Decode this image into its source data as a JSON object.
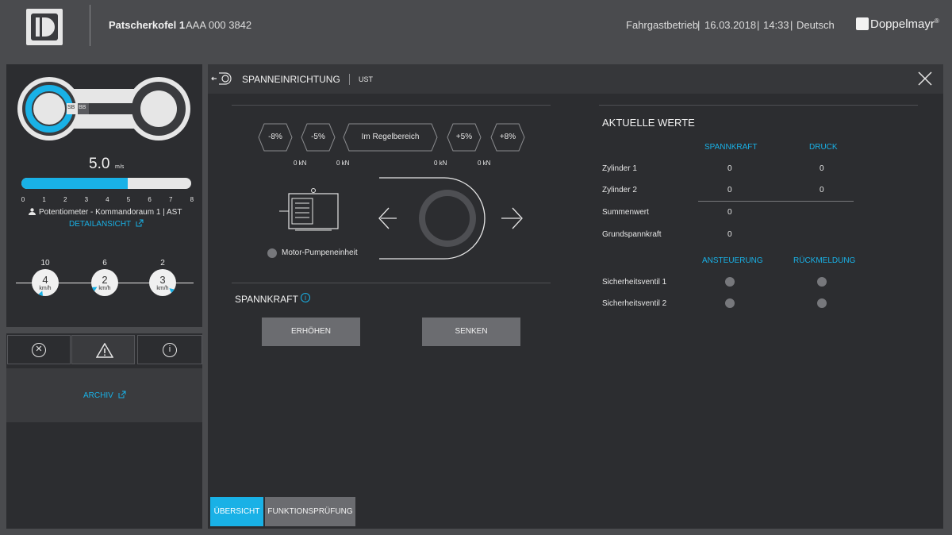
{
  "header": {
    "title": "Patscherkofel 1",
    "id": "AAA 000 3842",
    "mode": "Fahrgastbetrieb",
    "date": "16.03.2018",
    "time": "14:33",
    "language": "Deutsch",
    "brand": "Doppelmayr",
    "brand_mark": "®",
    "sep": "|"
  },
  "left": {
    "speed_value": "5.0",
    "speed_unit": "m/s",
    "speed_fraction_of_max": 0.625,
    "wheel_labels": [
      "SB",
      "BB"
    ],
    "scale_ticks": [
      "0",
      "1",
      "2",
      "3",
      "4",
      "5",
      "6",
      "7",
      "8"
    ],
    "source": "Potentiometer - Kommandoraum 1 | AST",
    "detail_link": "DETAILANSICHT",
    "gauges": [
      {
        "max": "10",
        "value": "4",
        "unit": "km/h"
      },
      {
        "max": "6",
        "value": "2",
        "unit": "km/h"
      },
      {
        "max": "2",
        "value": "3",
        "unit": "km/h"
      }
    ],
    "archive_link": "ARCHIV",
    "tabs": [
      "close-circle-icon",
      "warning-icon",
      "info-icon"
    ]
  },
  "main": {
    "section_title": "SPANNEINRICHTUNG",
    "section_sub": "UST",
    "steps": [
      {
        "label": "-8%",
        "kn": "0 kN"
      },
      {
        "label": "-5%",
        "kn": "0 kN"
      },
      {
        "label": "Im Regelbereich",
        "kn": ""
      },
      {
        "label": "+5%",
        "kn": "0 kN"
      },
      {
        "label": "+8%",
        "kn": "0 kN"
      }
    ],
    "motor_label": "Motor-Pumpeneinheit",
    "spannkraft_title": "SPANNKRAFT",
    "btn_increase": "ERHÖHEN",
    "btn_decrease": "SENKEN",
    "bottom_tabs": {
      "overview": "ÜBERSICHT",
      "function_test": "FUNKTIONSPRÜFUNG"
    }
  },
  "values": {
    "title": "AKTUELLE WERTE",
    "col_force": "SPANNKRAFT",
    "col_pressure": "DRUCK",
    "rows": [
      {
        "label": "Zylinder 1",
        "force": "0",
        "pressure": "0"
      },
      {
        "label": "Zylinder 2",
        "force": "0",
        "pressure": "0"
      },
      {
        "label": "Summenwert",
        "force": "0",
        "pressure": ""
      },
      {
        "label": "Grundspannkraft",
        "force": "0",
        "pressure": ""
      }
    ],
    "col_control": "ANSTEUERUNG",
    "col_feedback": "RÜCKMELDUNG",
    "valves": [
      {
        "label": "Sicherheitsventil 1"
      },
      {
        "label": "Sicherheitsventil 2"
      }
    ]
  },
  "colors": {
    "accent": "#19b1e6",
    "panel": "#2c2d30",
    "frame": "#4a4b4e"
  }
}
